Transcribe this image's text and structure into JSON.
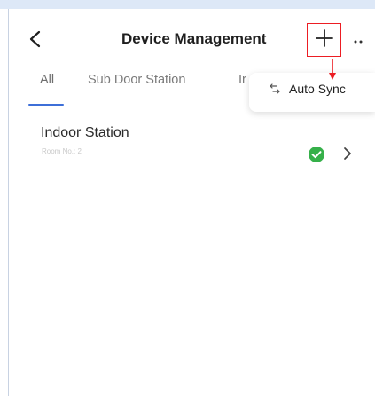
{
  "header": {
    "title": "Device Management",
    "back_icon": "chevron-left-icon",
    "add_icon": "plus-icon",
    "more_icon": "more-dots-icon"
  },
  "tabs": [
    {
      "label": "All",
      "selected": true
    },
    {
      "label": "Sub Door Station",
      "selected": false
    },
    {
      "label": "Ir",
      "selected": false
    }
  ],
  "popup": {
    "label": "Auto Sync",
    "icon": "sync-icon"
  },
  "devices": [
    {
      "name": "Indoor Station",
      "sub": "Room No.: 2",
      "status": "online",
      "status_icon": "check-circle-icon"
    }
  ],
  "colors": {
    "accent": "#3d6fd8",
    "highlight_box": "#ec1d23",
    "status_ok": "#36b04a",
    "top_band": "#dde8f7"
  }
}
